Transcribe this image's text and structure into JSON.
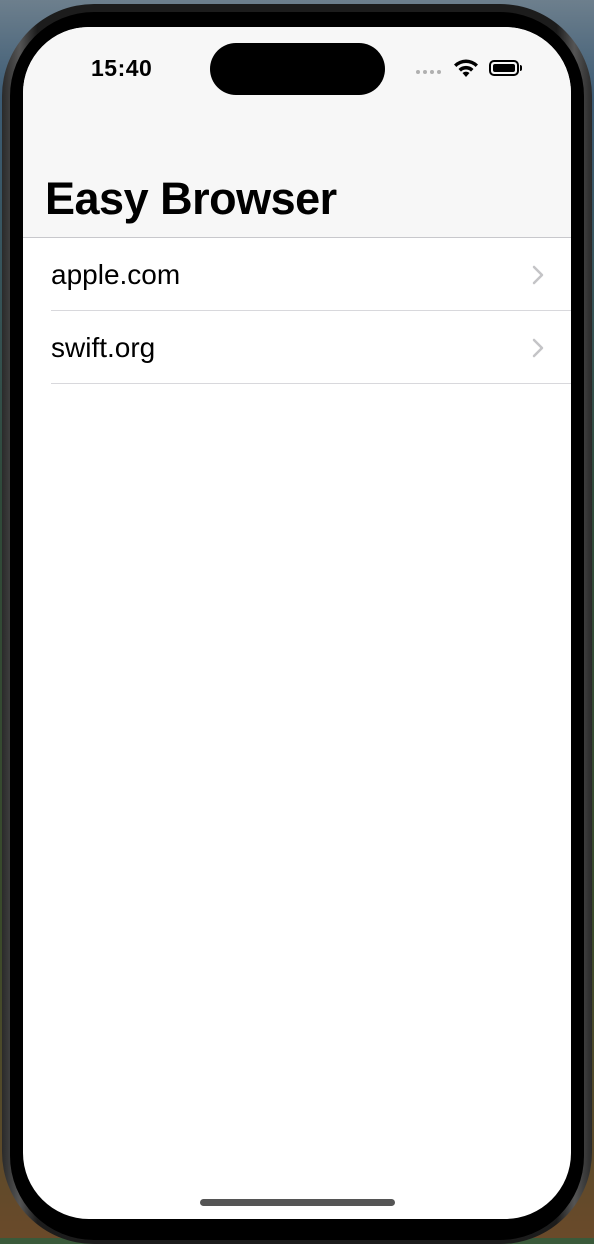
{
  "status_bar": {
    "time": "15:40",
    "signal_icon": "cellular-signal-dots-icon",
    "wifi_icon": "wifi-icon",
    "battery_icon": "battery-icon"
  },
  "navigation": {
    "title": "Easy Browser"
  },
  "list": {
    "items": [
      {
        "label": "apple.com",
        "accessory": "chevron-right-icon"
      },
      {
        "label": "swift.org",
        "accessory": "chevron-right-icon"
      }
    ]
  },
  "colors": {
    "nav_background": "#f7f7f7",
    "separator": "#d8d8dc",
    "chevron": "#c4c4c7",
    "text": "#000000"
  }
}
